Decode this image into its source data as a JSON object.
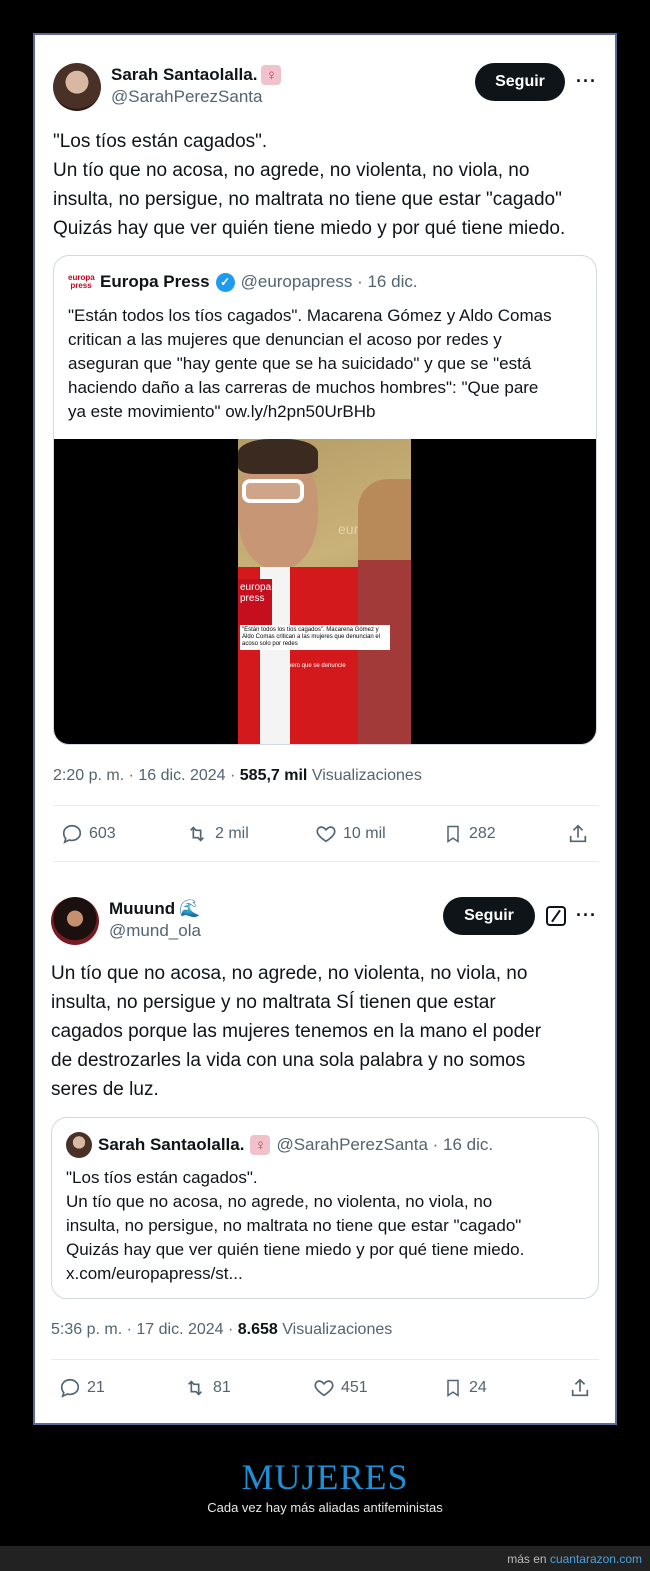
{
  "tweet1": {
    "author_name": "Sarah Santaolalla.",
    "badge": "♀",
    "handle": "@SarahPerezSanta",
    "follow_label": "Seguir",
    "more_label": "···",
    "text": "\"Los tíos están cagados\".\nUn tío que no acosa, no agrede, no violenta, no viola, no\ninsulta, no persigue, no maltrata no tiene que estar \"cagado\"\nQuizás hay que ver quién tiene miedo y por qué tiene miedo.",
    "quote": {
      "logo": "europa press",
      "name": "Europa Press",
      "verified_mark": "✓",
      "meta": "@europapress · 16 dic.",
      "text": "\"Están todos los tíos cagados\". Macarena Gómez y Aldo Comas\ncritican a las mujeres que denuncian el acoso por redes y\naseguran que \"hay gente que se ha suicidado\" y que se \"está\nhaciendo daño a las carreras de muchos hombres\": \"Que pare\nya este movimiento\" ow.ly/h2pn50UrBHb",
      "video_caption": "\"Están todos los tíos cagados\". Macarena Gómez y Aldo Comas critican a las mujeres que denuncian el acoso solo por redes",
      "video_subtitle": "pero que se denuncie",
      "mic_label": "europa press",
      "backdrop_label": "europa"
    },
    "time": "2:20 p. m. · 16 dic. 2024 · ",
    "views_count": "585,7 mil",
    "views_label": " Visualizaciones",
    "replies": "603",
    "reposts": "2 mil",
    "likes": "10 mil",
    "bookmarks": "282"
  },
  "tweet2": {
    "author_name": "Muuund",
    "badge": "🌊",
    "handle": "@mund_ola",
    "follow_label": "Seguir",
    "more_label": "···",
    "text": "Un tío que no acosa, no agrede, no violenta, no viola, no\ninsulta, no persigue y no maltrata SÍ tienen que estar\ncagados porque las mujeres tenemos en la mano el poder\nde destrozarles la vida con una sola palabra y no somos\nseres de luz.",
    "quote": {
      "name": "Sarah Santaolalla.",
      "badge": "♀",
      "meta": "@SarahPerezSanta · 16 dic.",
      "text": "\"Los tíos están cagados\".\nUn tío que no acosa, no agrede, no violenta, no viola, no\ninsulta, no persigue, no maltrata no tiene que estar \"cagado\"\nQuizás hay que ver quién tiene miedo y por qué tiene miedo.\nx.com/europapress/st..."
    },
    "time": "5:36 p. m. · 17 dic. 2024 · ",
    "views_count": "8.658",
    "views_label": " Visualizaciones",
    "replies": "21",
    "reposts": "81",
    "likes": "451",
    "bookmarks": "24"
  },
  "banner": {
    "title": "MUJERES",
    "subtitle": "Cada vez hay más aliadas antifeministas"
  },
  "footer": {
    "prefix": "más en ",
    "site": "cuantarazon.com"
  },
  "colors": {
    "accent": "#1d9bf0",
    "banner_title": "#1f8fd6",
    "frame_border": "#5b6b9a"
  }
}
